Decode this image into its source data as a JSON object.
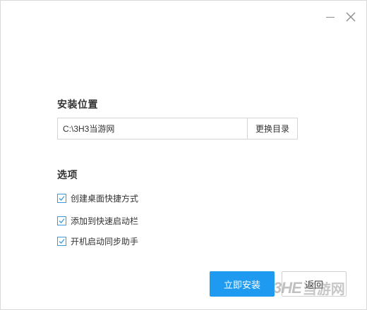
{
  "window": {
    "controls": {
      "minimize_icon": "minimize-icon",
      "close_icon": "close-icon"
    }
  },
  "install_location": {
    "title": "安装位置",
    "path_value": "C:\\3H3当游网",
    "browse_label": "更换目录"
  },
  "options": {
    "title": "选项",
    "items": [
      {
        "label": "创建桌面快捷方式",
        "checked": true
      },
      {
        "label": "添加到快速启动栏",
        "checked": true
      },
      {
        "label": "开机启动同步助手",
        "checked": true
      }
    ]
  },
  "actions": {
    "install_label": "立即安装",
    "back_label": "返回"
  },
  "watermark": {
    "logo": "3HE",
    "text": "当游网"
  },
  "colors": {
    "accent": "#1e9bf0",
    "checkbox_border": "#3a9ae0",
    "border": "#d4d4d4",
    "text": "#333333"
  }
}
